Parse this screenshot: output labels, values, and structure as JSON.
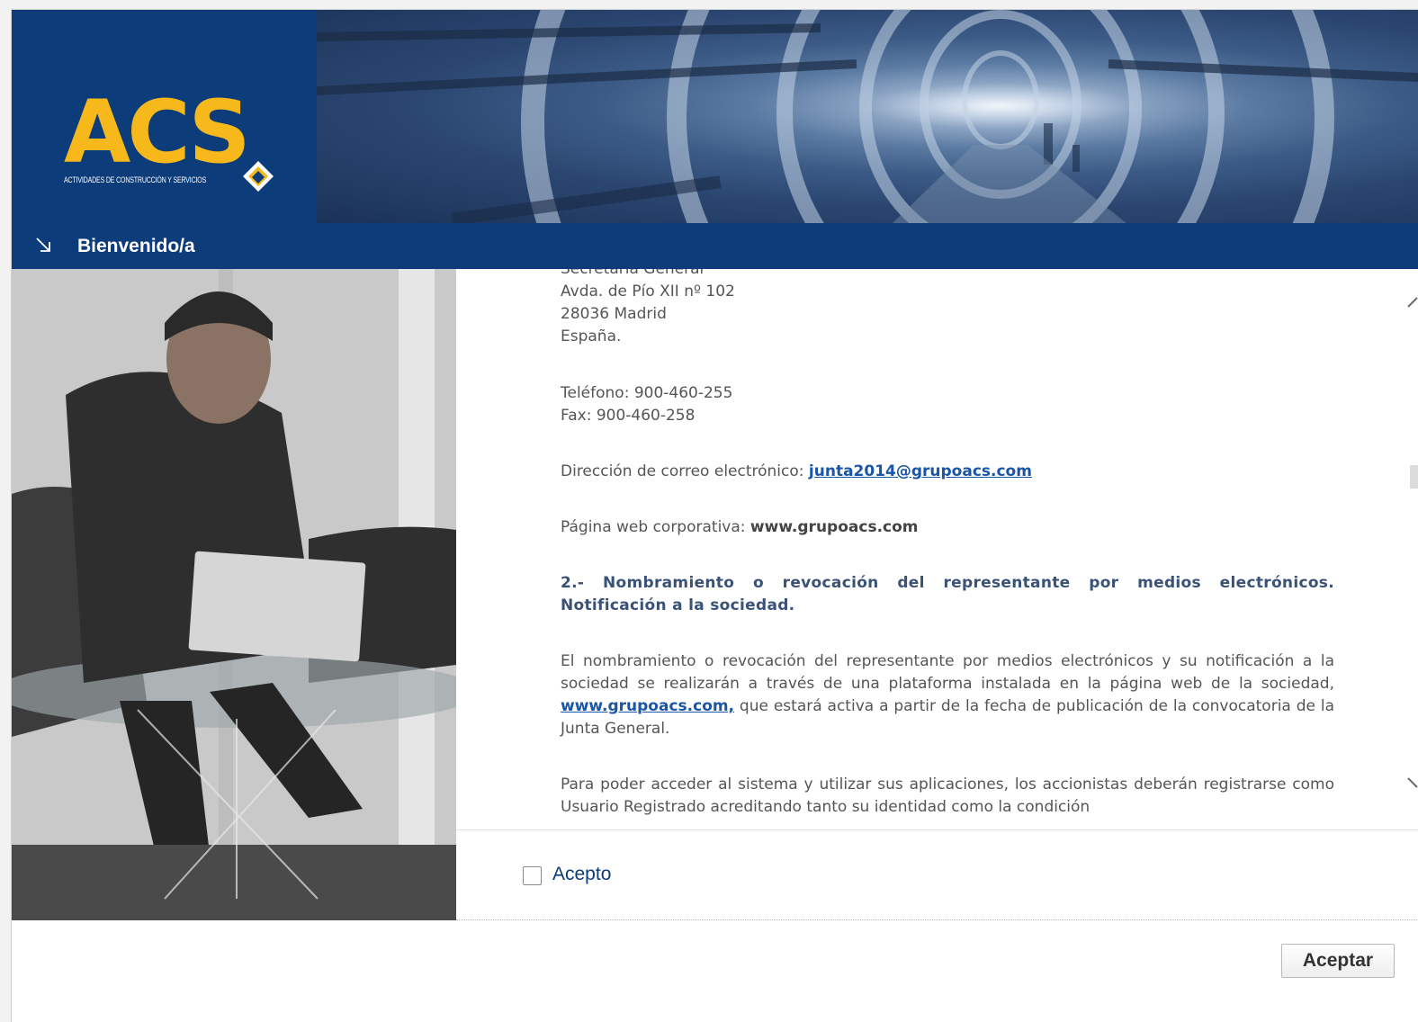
{
  "header": {
    "logo_text": "ACS",
    "logo_subtitle": "ACTIVIDADES DE CONSTRUCCIÓN Y SERVICIOS",
    "brand_color": "#0d3c7a",
    "accent_color": "#f6b81a"
  },
  "titlebar": {
    "arrow_icon": "arrow-down-right-icon",
    "title": "Bienvenido/a"
  },
  "content": {
    "address_line0": "Secretaría General",
    "address_line1": "Avda. de Pío XII nº 102",
    "address_line2": "28036 Madrid",
    "address_line3": "España.",
    "phone": "Teléfono: 900-460-255",
    "fax": "Fax: 900-460-258",
    "email_prefix": "Dirección de correo electrónico: ",
    "email": "junta2014@grupoacs.com",
    "web_prefix": "Página web corporativa: ",
    "web": "www.grupoacs.com",
    "section_heading": "2.- Nombramiento o revocación del representante por medios electrónicos. Notificación a la sociedad.",
    "para1_a": "El nombramiento o revocación del representante por medios electrónicos y su notificación a la sociedad se realizarán a través de una plataforma instalada en la página web de la sociedad, ",
    "para1_link": "www.grupoacs.com,",
    "para1_b": " que estará activa a partir de la fecha de publicación de la convocatoria de la Junta General.",
    "para2": "Para poder acceder al sistema y utilizar sus aplicaciones, los accionistas deberán registrarse como Usuario Registrado acreditando tanto su identidad como la condición"
  },
  "accept": {
    "checkbox_checked": false,
    "label": "Acepto"
  },
  "footer": {
    "accept_button": "Aceptar"
  }
}
